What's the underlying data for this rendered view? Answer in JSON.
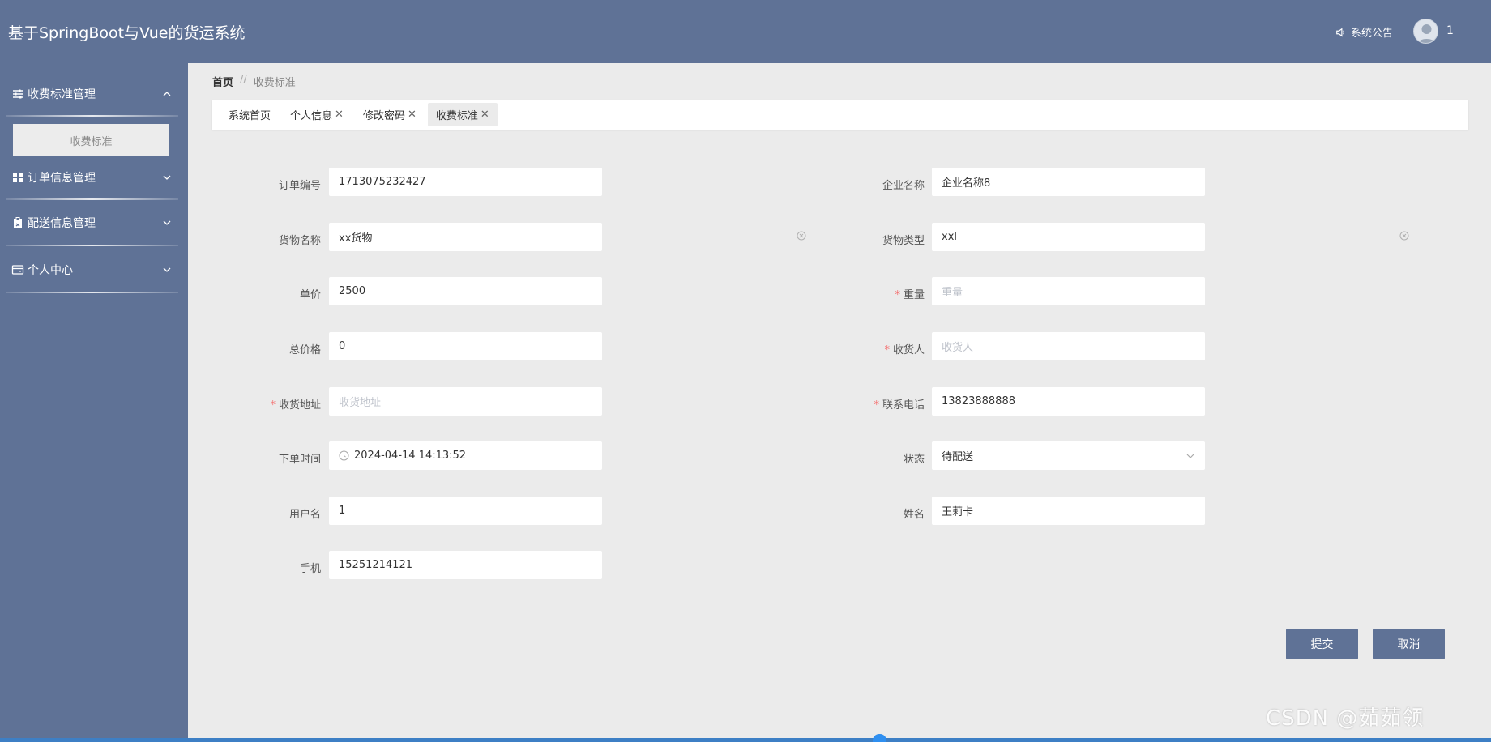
{
  "app": {
    "title": "基于SpringBoot与Vue的货运系统"
  },
  "header": {
    "notice_label": "系统公告",
    "username": "1"
  },
  "sidebar": {
    "items": [
      {
        "label": "收费标准管理",
        "icon": "sliders-icon",
        "expanded": true
      },
      {
        "label": "订单信息管理",
        "icon": "grid-icon",
        "expanded": false
      },
      {
        "label": "配送信息管理",
        "icon": "clipboard-icon",
        "expanded": false
      },
      {
        "label": "个人中心",
        "icon": "card-icon",
        "expanded": false
      }
    ],
    "submenu": [
      {
        "label": "收费标准"
      }
    ]
  },
  "breadcrumb": {
    "home": "首页",
    "separator": "//",
    "current": "收费标准"
  },
  "tabs": [
    {
      "label": "系统首页",
      "closable": false
    },
    {
      "label": "个人信息",
      "closable": true
    },
    {
      "label": "修改密码",
      "closable": true
    },
    {
      "label": "收费标准",
      "closable": true,
      "active": true
    }
  ],
  "form": {
    "order_no": {
      "label": "订单编号",
      "value": "1713075232427"
    },
    "company": {
      "label": "企业名称",
      "value": "企业名称8"
    },
    "goods_name": {
      "label": "货物名称",
      "value": "xx货物"
    },
    "goods_type": {
      "label": "货物类型",
      "value": "xxl"
    },
    "unit_price": {
      "label": "单价",
      "value": "2500"
    },
    "weight": {
      "label": "重量",
      "placeholder": "重量",
      "required": true
    },
    "total_price": {
      "label": "总价格",
      "value": "0"
    },
    "consignee": {
      "label": "收货人",
      "placeholder": "收货人",
      "required": true
    },
    "address": {
      "label": "收货地址",
      "placeholder": "收货地址",
      "required": true
    },
    "phone": {
      "label": "联系电话",
      "value": "13823888888",
      "required": true
    },
    "order_time": {
      "label": "下单时间",
      "value": "2024-04-14 14:13:52"
    },
    "status": {
      "label": "状态",
      "value": "待配送"
    },
    "user_name": {
      "label": "用户名",
      "value": "1"
    },
    "real_name": {
      "label": "姓名",
      "value": "王莉卡"
    },
    "mobile": {
      "label": "手机",
      "value": "15251214121"
    }
  },
  "buttons": {
    "submit": "提交",
    "cancel": "取消"
  },
  "watermark": "CSDN @茹茹领"
}
